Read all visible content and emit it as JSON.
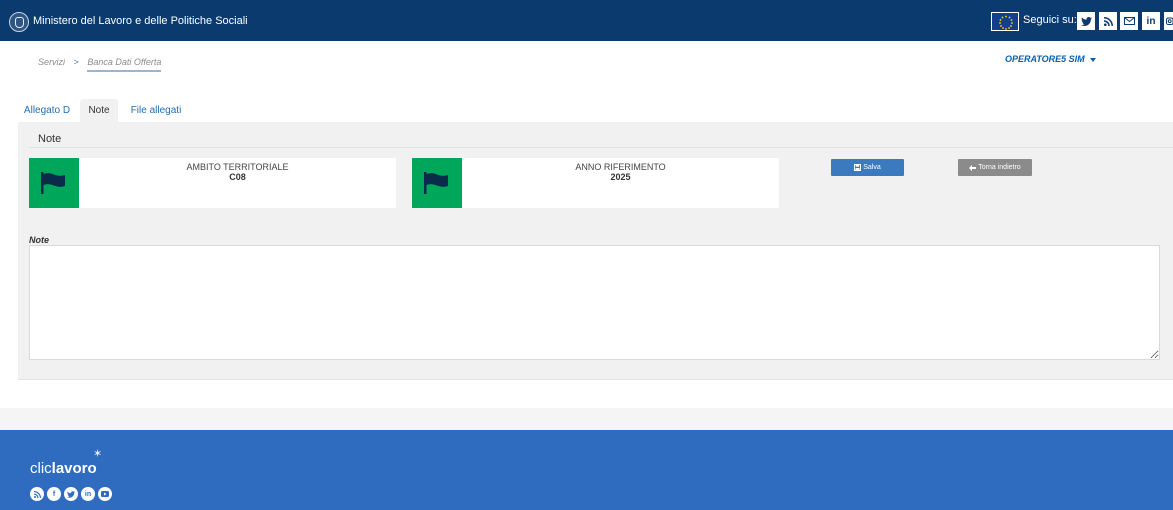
{
  "header": {
    "title": "Ministero del Lavoro e delle Politiche Sociali",
    "follow_label": "Seguici su:",
    "social_icons": [
      "twitter-icon",
      "rss-icon",
      "mail-icon",
      "linkedin-icon",
      "instagram-icon"
    ]
  },
  "breadcrumb": {
    "items": [
      "Servizi",
      "Banca Dati Offerta"
    ],
    "separator": ">"
  },
  "user": {
    "name": "OPERATORE5 SIM"
  },
  "tabs": [
    {
      "label": "Allegato D",
      "active": false
    },
    {
      "label": "Note",
      "active": true
    },
    {
      "label": "File allegati",
      "active": false
    }
  ],
  "panel": {
    "heading": "Note",
    "ambito": {
      "label": "AMBITO TERRITORIALE",
      "value": "C08"
    },
    "anno": {
      "label": "ANNO RIFERIMENTO",
      "value": "2025"
    },
    "save_label": "Salva",
    "back_label": "Torna indietro",
    "note_label": "Note",
    "note_value": ""
  },
  "footer": {
    "logo_light": "clic",
    "logo_bold": "lavoro",
    "social_icons": [
      "rss-icon",
      "facebook-icon",
      "twitter-icon",
      "linkedin-icon",
      "youtube-icon"
    ]
  },
  "colors": {
    "header_bg": "#0b3a6e",
    "footer_bg": "#2f6cc0",
    "flag_box": "#00a65a",
    "save_button": "#3c7abf",
    "back_button": "#8b8b8b",
    "tab_link": "#1f6fb2"
  }
}
